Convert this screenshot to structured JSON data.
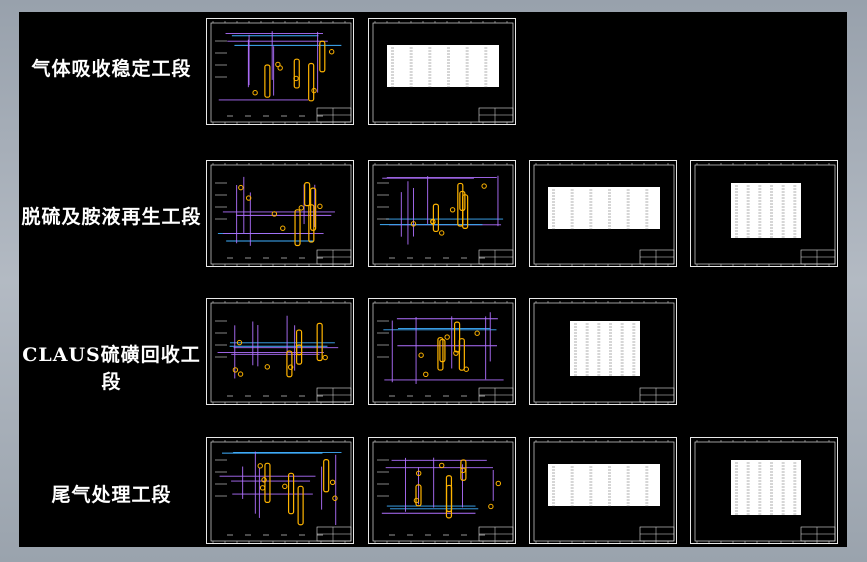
{
  "rows": [
    {
      "label": "气体吸收稳定工段",
      "sheets": [
        "pid",
        "table"
      ]
    },
    {
      "label": "脱硫及胺液再生工段",
      "sheets": [
        "pid",
        "pid",
        "table",
        "table"
      ]
    },
    {
      "label": "CLAUS硫磺回收工段",
      "sheets": [
        "pid",
        "pid",
        "table"
      ]
    },
    {
      "label": "尾气处理工段",
      "sheets": [
        "pid",
        "pid",
        "table",
        "table"
      ]
    }
  ],
  "colors": {
    "background": "#000000",
    "border": "#ffffff",
    "equipment": "#ffb400",
    "pipe_main": "#b070ff",
    "pipe_alt": "#40b0ff"
  }
}
